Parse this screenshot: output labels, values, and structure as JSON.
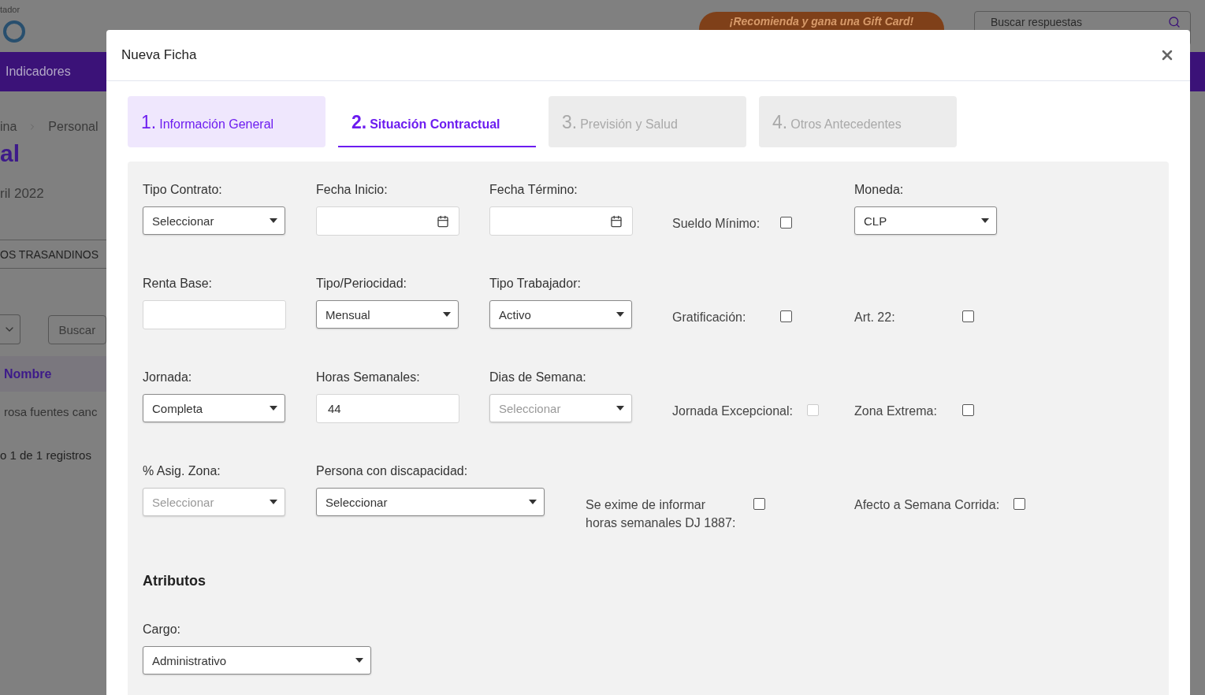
{
  "background_page": {
    "top_label": "tador",
    "promo_button": "¡Recomienda y gana una Gift Card!",
    "search": {
      "placeholder": "Buscar respuestas"
    },
    "nav_item": "Indicadores",
    "breadcrumb": [
      "ina",
      "Personal"
    ],
    "page_title": "al",
    "period": "ril 2022",
    "company_field": {
      "value": "OS TRASANDINOS"
    },
    "search_button": "Buscar",
    "table": {
      "column_1": "Nombre",
      "rows": [
        [
          "rosa fuentes canc"
        ]
      ]
    },
    "record_count": "o 1 de 1 registros"
  },
  "modal": {
    "title": "Nueva Ficha",
    "steps": [
      {
        "number": "1.",
        "label": "Información General",
        "selected": false,
        "completed": true
      },
      {
        "number": "2.",
        "label": "Situación Contractual",
        "selected": true,
        "completed": false
      },
      {
        "number": "3.",
        "label": "Previsión y Salud",
        "selected": false,
        "completed": false
      },
      {
        "number": "4.",
        "label": "Otros Antecedentes",
        "selected": false,
        "completed": false
      }
    ],
    "rows": [
      {
        "fields": [
          {
            "kind": "select",
            "label": "Tipo Contrato:",
            "value": "Seleccionar",
            "disabled": false
          },
          {
            "kind": "date",
            "label": "Fecha Inicio:"
          },
          {
            "kind": "date",
            "label": "Fecha Término:"
          },
          {
            "kind": "checkbox",
            "label": "Sueldo Mínimo:",
            "checked": false,
            "disabled": false
          },
          {
            "kind": "select",
            "label": "Moneda:",
            "value": "CLP",
            "disabled": false
          }
        ]
      },
      {
        "fields": [
          {
            "kind": "text",
            "label": "Renta Base:"
          },
          {
            "kind": "select",
            "label": "Tipo/Periocidad:",
            "value": "Mensual",
            "disabled": false
          },
          {
            "kind": "select",
            "label": "Tipo Trabajador:",
            "value": "Activo",
            "disabled": false
          },
          {
            "kind": "checkbox",
            "label": "Gratificación:",
            "checked": false,
            "disabled": false
          },
          {
            "kind": "checkbox",
            "label": "Art. 22:",
            "checked": false,
            "disabled": false
          }
        ]
      },
      {
        "fields": [
          {
            "kind": "select",
            "label": "Jornada:",
            "value": "Completa",
            "disabled": false
          },
          {
            "kind": "text",
            "label": "Horas Semanales:",
            "value": "44"
          },
          {
            "kind": "select",
            "label": "Dias de Semana:",
            "value": "Seleccionar",
            "disabled": true
          },
          {
            "kind": "checkbox",
            "label": "Jornada Excepcional:",
            "checked": false,
            "disabled": true
          },
          {
            "kind": "checkbox",
            "label": "Zona Extrema:",
            "checked": false,
            "disabled": false
          }
        ]
      },
      {
        "fields": [
          {
            "kind": "select",
            "label": "% Asig. Zona:",
            "value": "Seleccionar",
            "disabled": true
          },
          {
            "kind": "select",
            "label": "Persona con discapacidad:",
            "value": "Seleccionar",
            "disabled": false,
            "wide": true
          },
          {
            "kind": "checkbox",
            "label": "Se exime de informar horas semanales DJ 1887:",
            "checked": false,
            "disabled": false
          },
          {
            "kind": "checkbox",
            "label": "Afecto a Semana Corrida:",
            "checked": false,
            "disabled": false
          }
        ]
      }
    ],
    "section_title": "Atributos",
    "attribute_fields": [
      {
        "kind": "select",
        "label": "Cargo:",
        "value": "Administrativo",
        "disabled": false,
        "wide": true
      }
    ]
  }
}
